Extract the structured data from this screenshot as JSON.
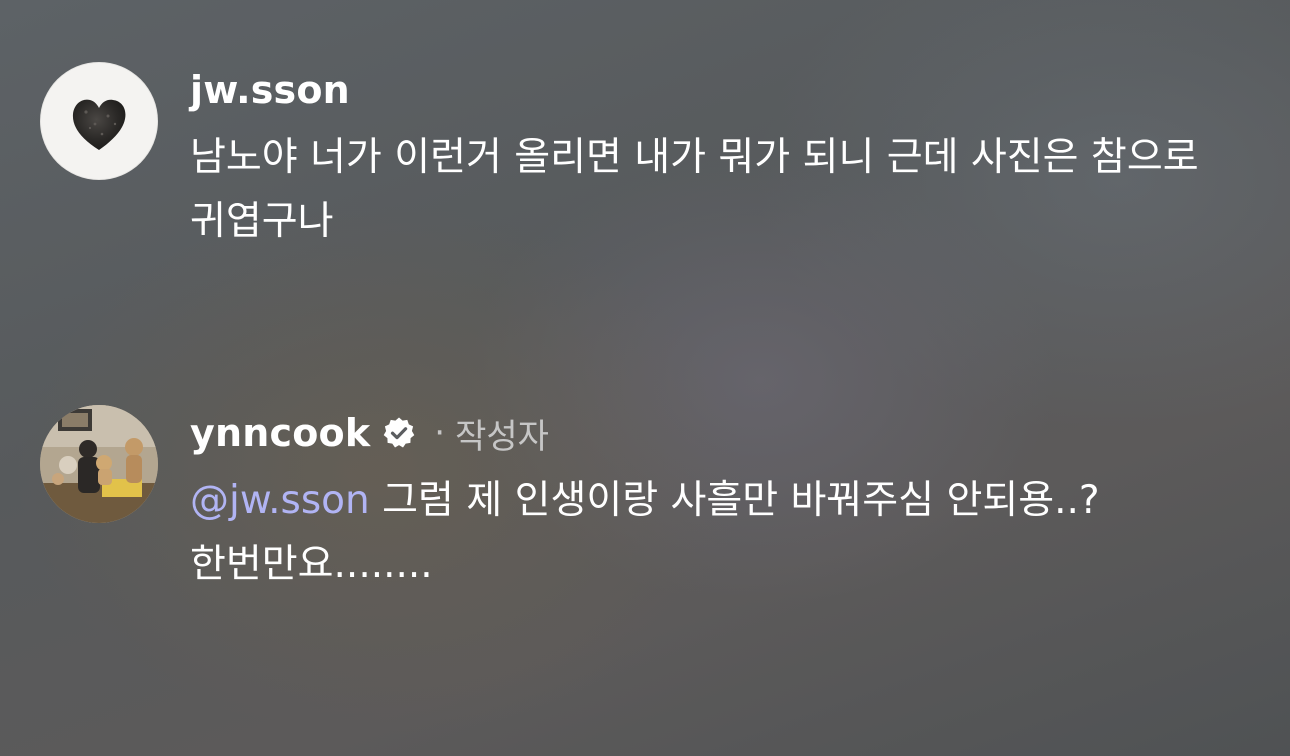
{
  "comments": [
    {
      "username": "jw.sson",
      "avatar_icon": "heart-icon",
      "text": "남노야 너가 이런거 올리면 내가 뭐가 되니 근데 사진은 참으로 귀엽구나"
    },
    {
      "username": "ynncook",
      "verified_icon": "verified-badge-icon",
      "separator": "·",
      "author_label": "작성자",
      "mention": "@jw.sson",
      "text": " 그럼 제 인생이랑 사흘만 바꿔주심 안되용..? 한번만요........"
    }
  ],
  "colors": {
    "mention": "#b1b4f4",
    "secondary_text": "#c6c6c6",
    "primary_text": "#ffffff"
  }
}
